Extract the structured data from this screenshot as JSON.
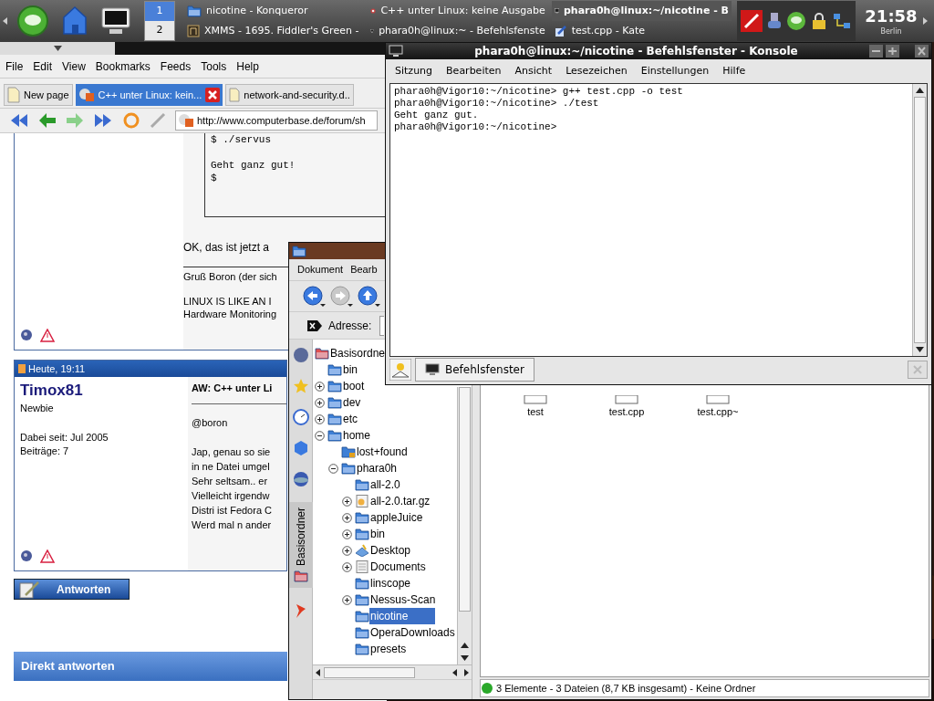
{
  "taskbar": {
    "pager": [
      {
        "label": "1",
        "selected": true
      },
      {
        "label": "2",
        "selected": false
      }
    ],
    "tasks": [
      {
        "label": "nicotine - Konqueror",
        "kind": "folder",
        "selected": false
      },
      {
        "label": "C++ unter Linux: keine Ausgabe",
        "kind": "web",
        "selected": false
      },
      {
        "label": "phara0h@linux:~/nicotine - B",
        "kind": "terminal",
        "selected": true
      },
      {
        "label": "XMMS - 1695. Fiddler's Green -",
        "kind": "music",
        "selected": false
      },
      {
        "label": "phara0h@linux:~ - Befehlsfenste",
        "kind": "terminal",
        "selected": false
      },
      {
        "label": "test.cpp - Kate",
        "kind": "editor",
        "selected": false
      }
    ],
    "clock": "21:58",
    "timezone": "Berlin"
  },
  "browser": {
    "menu": [
      "File",
      "Edit",
      "View",
      "Bookmarks",
      "Feeds",
      "Tools",
      "Help"
    ],
    "tabs": [
      {
        "label": "New page",
        "kind": "new",
        "selected": false
      },
      {
        "label": "C++ unter Linux: kein...",
        "kind": "site",
        "selected": true
      },
      {
        "label": "network-and-security.d..",
        "kind": "doc",
        "selected": false
      }
    ],
    "url": "http://www.computerbase.de/forum/sh",
    "post1": {
      "code_blocks": [
        [
          "$ ./servus"
        ],
        [
          "Geht ganz gut!",
          "$"
        ]
      ],
      "text": "OK, das ist jetzt a",
      "signature_blocks": [
        [
          "Gruß Boron (der sich"
        ],
        [
          "LINUX IS LIKE AN I",
          "Hardware Monitoring"
        ]
      ]
    },
    "post2": {
      "date": "Heute, 19:11",
      "author": "Timox81",
      "rank": "Newbie",
      "info": [
        "Dabei seit: Jul 2005",
        "Beiträge: 7"
      ],
      "title": "AW: C++ unter Li",
      "greeting": "@boron",
      "body": [
        "Jap, genau so sie",
        "in ne Datei umgel",
        "Sehr seltsam.. er",
        "Vielleicht irgendw",
        "Distri ist Fedora C",
        "Werd mal n ander"
      ]
    },
    "reply_button": "Antworten",
    "quick_reply": "Direkt antworten"
  },
  "konsole": {
    "title": "phara0h@linux:~/nicotine - Befehlsfenster - Konsole",
    "menu": [
      "Sitzung",
      "Bearbeiten",
      "Ansicht",
      "Lesezeichen",
      "Einstellungen",
      "Hilfe"
    ],
    "lines": [
      "phara0h@Vigor10:~/nicotine> g++ test.cpp -o test",
      "phara0h@Vigor10:~/nicotine> ./test",
      "Geht ganz gut.",
      "phara0h@Vigor10:~/nicotine>"
    ],
    "tabs": [
      {
        "label": "Befehlsfenster",
        "selected": true
      }
    ]
  },
  "konqueror": {
    "menu": [
      "Dokument",
      "Bearb"
    ],
    "toolbar": [
      {
        "kind": "back",
        "disabled": false
      },
      {
        "kind": "forward",
        "disabled": true
      },
      {
        "kind": "up",
        "disabled": false
      }
    ],
    "address_label": "Adresse:",
    "sidebar_tab": "Basisordner",
    "tree": [
      {
        "label": "Basisordne",
        "kind": "root",
        "selected": false,
        "children": [
          {
            "label": "bin",
            "kind": "folder",
            "selected": false
          },
          {
            "label": "boot",
            "kind": "folder",
            "expanded": false,
            "selected": false
          },
          {
            "label": "dev",
            "kind": "folder",
            "expanded": false,
            "selected": false
          },
          {
            "label": "etc",
            "kind": "folder",
            "expanded": false,
            "selected": false
          },
          {
            "label": "home",
            "kind": "folder",
            "expanded": true,
            "selected": false,
            "children": [
              {
                "label": "lost+found",
                "kind": "locked",
                "selected": false
              },
              {
                "label": "phara0h",
                "kind": "folder",
                "expanded": true,
                "selected": false,
                "children": [
                  {
                    "label": "all-2.0",
                    "kind": "folder",
                    "selected": false
                  },
                  {
                    "label": "all-2.0.tar.gz",
                    "kind": "archive",
                    "expanded": false,
                    "selected": false
                  },
                  {
                    "label": "appleJuice",
                    "kind": "folder",
                    "expanded": false,
                    "selected": false
                  },
                  {
                    "label": "bin",
                    "kind": "folder",
                    "expanded": false,
                    "selected": false
                  },
                  {
                    "label": "Desktop",
                    "kind": "desktop",
                    "expanded": false,
                    "selected": false
                  },
                  {
                    "label": "Documents",
                    "kind": "document",
                    "expanded": false,
                    "selected": false
                  },
                  {
                    "label": "linscope",
                    "kind": "folder",
                    "selected": false
                  },
                  {
                    "label": "Nessus-Scan",
                    "kind": "folder",
                    "expanded": false,
                    "selected": false
                  },
                  {
                    "label": "nicotine",
                    "kind": "folder",
                    "selected": true
                  },
                  {
                    "label": "OperaDownloads",
                    "kind": "folder",
                    "selected": false
                  },
                  {
                    "label": "presets",
                    "kind": "folder",
                    "selected": false
                  }
                ]
              }
            ]
          }
        ]
      }
    ],
    "files": [
      {
        "label": "test"
      },
      {
        "label": "test.cpp"
      },
      {
        "label": "test.cpp~"
      }
    ],
    "status": "3 Elemente - 3 Dateien (8,7 KB insgesamt) - Keine Ordner"
  }
}
